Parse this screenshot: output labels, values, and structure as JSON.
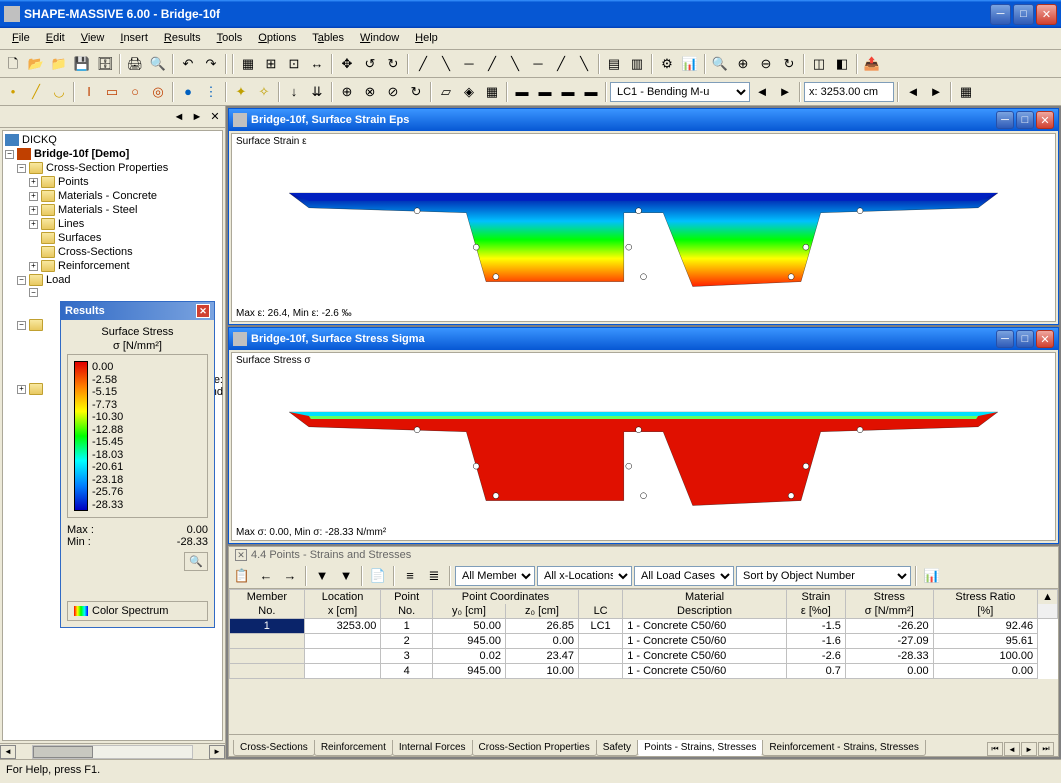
{
  "app": {
    "title": "SHAPE-MASSIVE 6.00 - Bridge-10f"
  },
  "menu": [
    "File",
    "Edit",
    "View",
    "Insert",
    "Results",
    "Tools",
    "Options",
    "Tables",
    "Window",
    "Help"
  ],
  "toolbar2": {
    "load_case_combo": "LC1 - Bending M-u",
    "x_input": "x: 3253.00 cm"
  },
  "nav": {
    "root": "DICKQ",
    "project": "Bridge-10f [Demo]",
    "groups": {
      "csp": "Cross-Section Properties",
      "csp_items": [
        "Points",
        "Materials - Concrete",
        "Materials - Steel",
        "Lines",
        "Surfaces",
        "Cross-Sections",
        "Reinforcement"
      ],
      "load": "Load",
      "ssc": "sse:",
      "and": "and"
    }
  },
  "results_panel": {
    "title": "Results",
    "legend_title": "Surface Stress",
    "legend_unit": "σ     [N/mm²]",
    "ticks": [
      "0.00",
      "-2.58",
      "-5.15",
      "-7.73",
      "-10.30",
      "-12.88",
      "-15.45",
      "-18.03",
      "-20.61",
      "-23.18",
      "-25.76",
      "-28.33"
    ],
    "max_label": "Max :",
    "max_value": "0.00",
    "min_label": "Min :",
    "min_value": "-28.33",
    "spectrum_btn": "Color Spectrum"
  },
  "mdi": {
    "strain": {
      "title": "Bridge-10f, Surface Strain Eps",
      "label": "Surface Strain ε",
      "footer": "Max ε: 26.4, Min ε: -2.6 ‰"
    },
    "stress": {
      "title": "Bridge-10f, Surface Stress Sigma",
      "label": "Surface Stress σ",
      "footer": "Max σ: 0.00, Min σ: -28.33 N/mm²"
    }
  },
  "table": {
    "title": "4.4 Points - Strains and Stresses",
    "combos": [
      "All Members",
      "All x-Locations",
      "All Load Cases",
      "Sort by Object Number"
    ],
    "headers_top": [
      "Member",
      "Location",
      "Point",
      "Point Coordinates",
      "",
      "",
      "Material",
      "Strain",
      "Stress",
      "Stress Ratio"
    ],
    "headers_bot": [
      "No.",
      "x [cm]",
      "No.",
      "y₀ [cm]",
      "z₀ [cm]",
      "LC",
      "Description",
      "ε [%o]",
      "σ [N/mm²]",
      "[%]"
    ],
    "rows": [
      {
        "member": "1",
        "x": "3253.00",
        "pt": "1",
        "y0": "50.00",
        "z0": "26.85",
        "lc": "LC1",
        "mat": "1 - Concrete C50/60",
        "strain": "-1.5",
        "stress": "-26.20",
        "ratio": "92.46"
      },
      {
        "member": "",
        "x": "",
        "pt": "2",
        "y0": "945.00",
        "z0": "0.00",
        "lc": "",
        "mat": "1 - Concrete C50/60",
        "strain": "-1.6",
        "stress": "-27.09",
        "ratio": "95.61"
      },
      {
        "member": "",
        "x": "",
        "pt": "3",
        "y0": "0.02",
        "z0": "23.47",
        "lc": "",
        "mat": "1 - Concrete C50/60",
        "strain": "-2.6",
        "stress": "-28.33",
        "ratio": "100.00"
      },
      {
        "member": "",
        "x": "",
        "pt": "4",
        "y0": "945.00",
        "z0": "10.00",
        "lc": "",
        "mat": "1 - Concrete C50/60",
        "strain": "0.7",
        "stress": "0.00",
        "ratio": "0.00"
      }
    ],
    "tabs": [
      "Cross-Sections",
      "Reinforcement",
      "Internal Forces",
      "Cross-Section Properties",
      "Safety",
      "Points - Strains, Stresses",
      "Reinforcement - Strains, Stresses"
    ]
  },
  "statusbar": "For Help, press F1."
}
